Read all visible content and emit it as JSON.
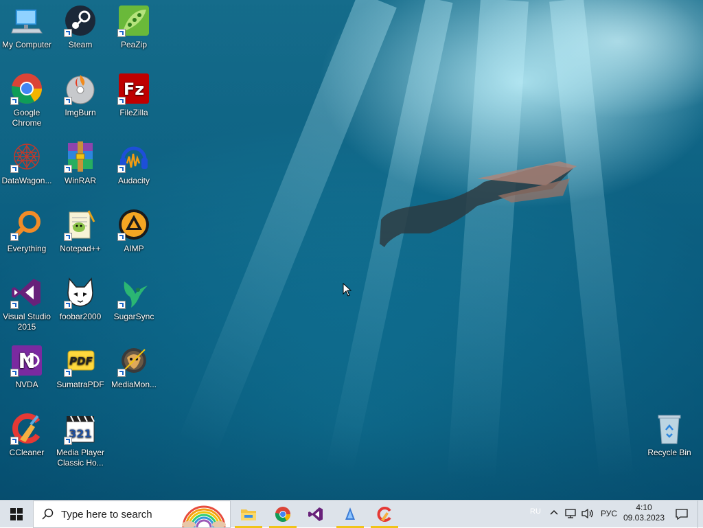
{
  "desktop": {
    "icons": [
      {
        "label": "My Computer",
        "icon": "computer-icon"
      },
      {
        "label": "Steam",
        "icon": "steam-icon"
      },
      {
        "label": "PeaZip",
        "icon": "peazip-icon"
      },
      {
        "label": "Google Chrome",
        "icon": "chrome-icon"
      },
      {
        "label": "ImgBurn",
        "icon": "imgburn-icon"
      },
      {
        "label": "FileZilla",
        "icon": "filezilla-icon"
      },
      {
        "label": "DataWagon...",
        "icon": "datawagon-icon"
      },
      {
        "label": "WinRAR",
        "icon": "winrar-icon"
      },
      {
        "label": "Audacity",
        "icon": "audacity-icon"
      },
      {
        "label": "Everything",
        "icon": "everything-icon"
      },
      {
        "label": "Notepad++",
        "icon": "notepad-plus-plus-icon"
      },
      {
        "label": "AIMP",
        "icon": "aimp-icon"
      },
      {
        "label": "Visual Studio 2015",
        "icon": "visual-studio-icon"
      },
      {
        "label": "foobar2000",
        "icon": "foobar2000-icon"
      },
      {
        "label": "SugarSync",
        "icon": "sugarsync-icon"
      },
      {
        "label": "NVDA",
        "icon": "nvda-icon"
      },
      {
        "label": "SumatraPDF",
        "icon": "sumatrapdf-icon"
      },
      {
        "label": "MediaMon...",
        "icon": "mediamonkey-icon"
      },
      {
        "label": "CCleaner",
        "icon": "ccleaner-icon"
      },
      {
        "label": "Media Player Classic Ho...",
        "icon": "mpc-hc-icon"
      },
      {
        "label": "Recycle Bin",
        "icon": "recycle-bin-icon"
      }
    ]
  },
  "taskbar": {
    "search_placeholder": "Type here to search",
    "pinned": [
      "file-explorer-icon",
      "chrome-icon",
      "visual-studio-icon",
      "sugarsync-icon",
      "ccleaner-icon"
    ],
    "tray": {
      "language_small": "RU",
      "language": "РУС",
      "time": "4:10",
      "date": "09.03.2023"
    }
  },
  "colors": {
    "taskbar_bg": "#dde3ea",
    "running_indicator": "#f0c419",
    "wallpaper_deep": "#0d6788",
    "wallpaper_light": "#2a9cb7"
  }
}
